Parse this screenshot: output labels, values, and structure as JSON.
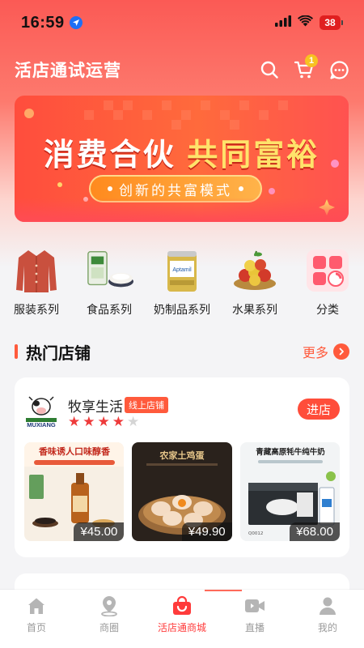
{
  "status_bar": {
    "time": "16:59",
    "battery": "38"
  },
  "header": {
    "title": "活店通试运营",
    "cart_count": "1"
  },
  "banner": {
    "title_white": "消费合伙",
    "title_gold": "共同富裕",
    "subtitle": "创新的共富模式"
  },
  "categories": [
    {
      "label": "服装系列",
      "icon": "sweater-icon"
    },
    {
      "label": "食品系列",
      "icon": "rice-icon"
    },
    {
      "label": "奶制品系列",
      "icon": "milk-powder-icon"
    },
    {
      "label": "水果系列",
      "icon": "fruit-icon"
    },
    {
      "label": "分类",
      "icon": "category-grid-icon"
    }
  ],
  "section": {
    "title": "热门店铺",
    "more": "更多"
  },
  "shop": {
    "name": "牧享生活",
    "tag": "线上店铺",
    "logo_text": "MUXIANG",
    "rating": 4,
    "rating_max": 5,
    "enter_label": "进店",
    "products": [
      {
        "price": "¥45.00",
        "image": "sesame-oil-product",
        "headline": "香味诱人口味醇香"
      },
      {
        "price": "¥49.90",
        "image": "eggs-product",
        "headline": "农家土鸡蛋"
      },
      {
        "price": "¥68.00",
        "image": "yak-milk-product",
        "headline": "青藏高原牦牛纯牛奶"
      }
    ]
  },
  "tabbar": [
    {
      "label": "首页",
      "icon": "home-icon",
      "active": false
    },
    {
      "label": "商圈",
      "icon": "location-pin-icon",
      "active": false
    },
    {
      "label": "活店通商城",
      "icon": "shopping-bag-icon",
      "active": true
    },
    {
      "label": "直播",
      "icon": "video-camera-icon",
      "active": false
    },
    {
      "label": "我的",
      "icon": "user-icon",
      "active": false
    }
  ],
  "colors": {
    "primary": "#ff4d3a",
    "gold": "#ffe36b",
    "star": "#ee3b3b"
  }
}
